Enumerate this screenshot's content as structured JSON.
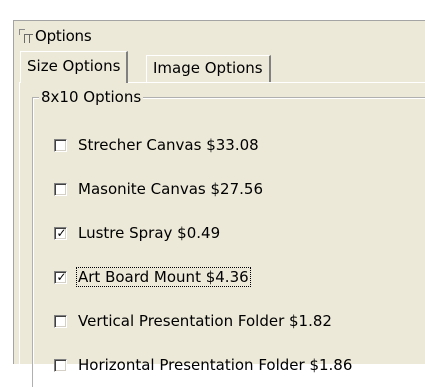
{
  "window": {
    "title": "Options",
    "icon": "app-window-icon"
  },
  "tabs": [
    {
      "label": "Size Options",
      "active": true
    },
    {
      "label": "Image Options",
      "active": false
    }
  ],
  "group": {
    "legend": "8x10 Options",
    "options": [
      {
        "label": "Strecher Canvas $33.08",
        "checked": false,
        "focused": false
      },
      {
        "label": "Masonite Canvas $27.56",
        "checked": false,
        "focused": false
      },
      {
        "label": "Lustre Spray $0.49",
        "checked": true,
        "focused": false
      },
      {
        "label": "Art Board Mount $4.36",
        "checked": true,
        "focused": true
      },
      {
        "label": "Vertical Presentation Folder $1.82",
        "checked": false,
        "focused": false
      },
      {
        "label": "Horizontal Presentation Folder $1.86",
        "checked": false,
        "focused": false
      }
    ]
  },
  "colors": {
    "background": "#ece9d8",
    "shadow": "#808080",
    "highlight": "#ffffff"
  }
}
